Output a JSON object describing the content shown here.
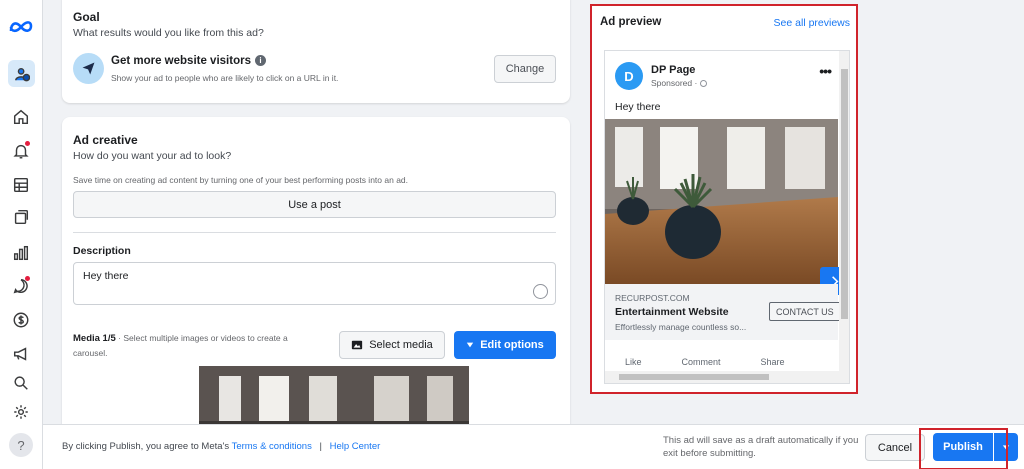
{
  "colors": {
    "accent": "#1877f2",
    "highlight": "#d0232b",
    "background": "#f0f2f5"
  },
  "rail": {
    "icons": [
      "meta-logo-icon",
      "page-avatar",
      "home-icon",
      "notifications-icon",
      "table-icon",
      "pages-icon",
      "chart-icon",
      "messages-icon",
      "dollar-icon",
      "megaphone-icon",
      "search-icon",
      "settings-icon",
      "help-icon"
    ],
    "help_label": "?"
  },
  "goal": {
    "title": "Goal",
    "question": "What results would you like from this ad?",
    "option_title": "Get more website visitors",
    "info_glyph": "i",
    "option_desc": "Show your ad to people who are likely to click on a URL in it.",
    "change_label": "Change"
  },
  "creative": {
    "title": "Ad creative",
    "question": "How do you want your ad to look?",
    "hint": "Save time on creating ad content by turning one of your best performing posts into an ad.",
    "use_post_label": "Use a post",
    "description_label": "Description",
    "description_value": "Hey there",
    "media_label": "Media 1/5",
    "media_hint": " · Select multiple images or videos to create a carousel.",
    "select_media_label": "Select media",
    "edit_options_label": "Edit options"
  },
  "preview": {
    "title": "Ad preview",
    "see_all": "See all previews",
    "avatar_letter": "D",
    "page_name": "DP Page",
    "sponsored": "Sponsored",
    "more_glyph": "•••",
    "post_text": "Hey there",
    "domain": "RECURPOST.COM",
    "link_title": "Entertainment Website",
    "link_desc": "Effortlessly manage countless so...",
    "cta": "CONTACT US",
    "actions": [
      "Like",
      "Comment",
      "Share"
    ]
  },
  "footer": {
    "legal_prefix": "By clicking Publish, you agree to Meta's ",
    "terms": "Terms & conditions",
    "separator": "|",
    "help_center": "Help Center",
    "draft_note": "This ad will save as a draft automatically if you exit before submitting.",
    "cancel": "Cancel",
    "publish": "Publish"
  }
}
